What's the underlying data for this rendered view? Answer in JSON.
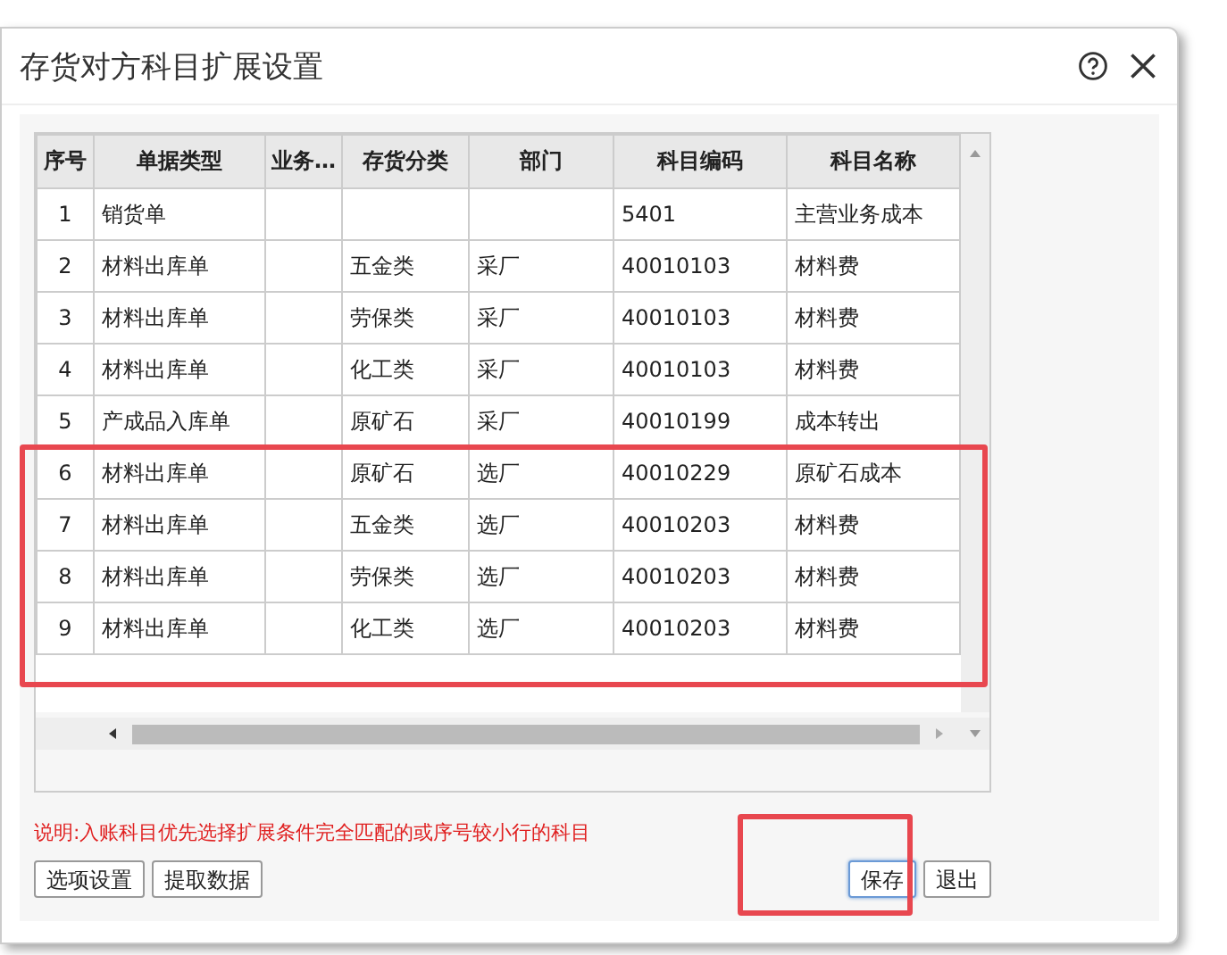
{
  "window": {
    "title": "存货对方科目扩展设置"
  },
  "table": {
    "columns": [
      "序号",
      "单据类型",
      "业务…",
      "存货分类",
      "部门",
      "科目编码",
      "科目名称"
    ],
    "rows": [
      [
        "1",
        "销货单",
        "",
        "",
        "",
        "5401",
        "主营业务成本"
      ],
      [
        "2",
        "材料出库单",
        "",
        "五金类",
        "采厂",
        "40010103",
        "材料费"
      ],
      [
        "3",
        "材料出库单",
        "",
        "劳保类",
        "采厂",
        "40010103",
        "材料费"
      ],
      [
        "4",
        "材料出库单",
        "",
        "化工类",
        "采厂",
        "40010103",
        "材料费"
      ],
      [
        "5",
        "产成品入库单",
        "",
        "原矿石",
        "采厂",
        "40010199",
        "成本转出"
      ],
      [
        "6",
        "材料出库单",
        "",
        "原矿石",
        "选厂",
        "40010229",
        "原矿石成本"
      ],
      [
        "7",
        "材料出库单",
        "",
        "五金类",
        "选厂",
        "40010203",
        "材料费"
      ],
      [
        "8",
        "材料出库单",
        "",
        "劳保类",
        "选厂",
        "40010203",
        "材料费"
      ],
      [
        "9",
        "材料出库单",
        "",
        "化工类",
        "选厂",
        "40010203",
        "材料费"
      ]
    ]
  },
  "note": "说明:入账科目优先选择扩展条件完全匹配的或序号较小行的科目",
  "left_buttons": [
    "选项设置",
    "提取数据"
  ],
  "right_buttons": [
    {
      "label": "保存",
      "selected": true
    },
    {
      "label": "退出",
      "selected": false
    }
  ]
}
